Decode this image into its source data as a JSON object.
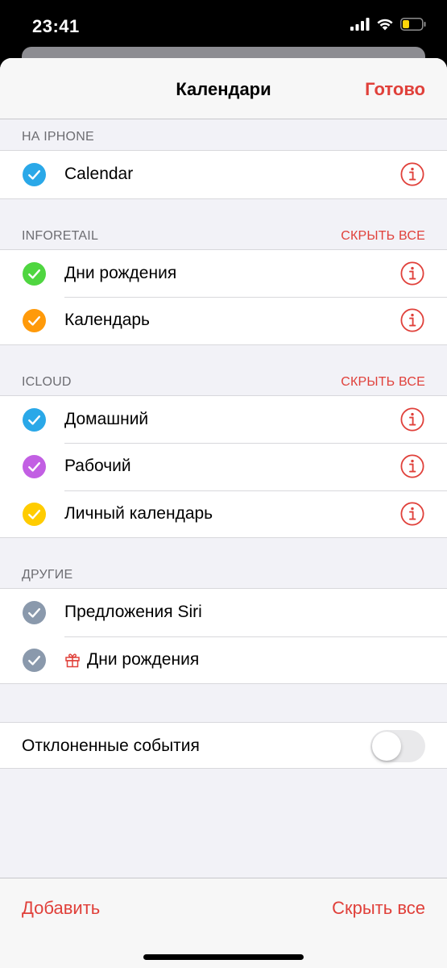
{
  "status_bar": {
    "time": "23:41",
    "icons": [
      "signal-icon",
      "wifi-icon",
      "battery-icon"
    ]
  },
  "nav": {
    "title": "Календари",
    "done_label": "Готово"
  },
  "sections": [
    {
      "header": "НА IPHONE",
      "action": "",
      "items": [
        {
          "label": "Calendar",
          "color": "#2aa8e8",
          "checked": true,
          "info": true
        }
      ]
    },
    {
      "header": "INFORETAIL",
      "action": "СКРЫТЬ ВСЕ",
      "items": [
        {
          "label": "Дни рождения",
          "color": "#4fd640",
          "checked": true,
          "info": true
        },
        {
          "label": "Календарь",
          "color": "#ff9a0a",
          "checked": true,
          "info": true
        }
      ]
    },
    {
      "header": "ICLOUD",
      "action": "СКРЫТЬ ВСЕ",
      "items": [
        {
          "label": "Домашний",
          "color": "#2aa8e8",
          "checked": true,
          "info": true
        },
        {
          "label": "Рабочий",
          "color": "#c25fe3",
          "checked": true,
          "info": true
        },
        {
          "label": "Личный календарь",
          "color": "#ffcc00",
          "checked": true,
          "info": true
        }
      ]
    },
    {
      "header": "ДРУГИЕ",
      "action": "",
      "items": [
        {
          "label": "Предложения Siri",
          "color": "#8a99ac",
          "checked": true,
          "info": false
        },
        {
          "label": "Дни рождения",
          "color": "#8a99ac",
          "checked": true,
          "info": false,
          "gift_icon": true
        }
      ]
    }
  ],
  "declined": {
    "label": "Отклоненные события",
    "enabled": false
  },
  "toolbar": {
    "add_label": "Добавить",
    "hide_all_label": "Скрыть все"
  },
  "colors": {
    "accent": "#e0403a",
    "background": "#f2f2f7"
  }
}
